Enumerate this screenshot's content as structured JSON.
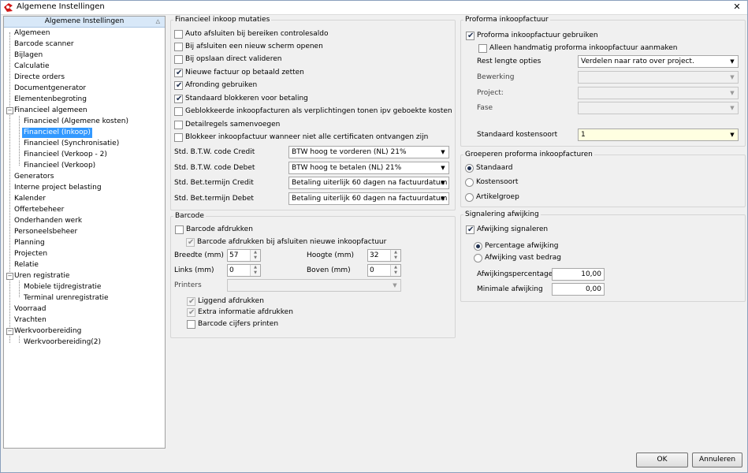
{
  "window": {
    "title": "Algemene Instellingen",
    "close_glyph": "✕"
  },
  "tree": {
    "header": "Algemene Instellingen",
    "header_arrow": "△",
    "items": [
      {
        "label": "Algemeen"
      },
      {
        "label": "Barcode scanner"
      },
      {
        "label": "Bijlagen"
      },
      {
        "label": "Calculatie"
      },
      {
        "label": "Directe orders"
      },
      {
        "label": "Documentgenerator"
      },
      {
        "label": "Elementenbegroting"
      },
      {
        "label": "Financieel algemeen"
      },
      {
        "label": "Financieel (Algemene kosten)"
      },
      {
        "label": "Financieel (Inkoop)"
      },
      {
        "label": "Financieel (Synchronisatie)"
      },
      {
        "label": "Financieel (Verkoop - 2)"
      },
      {
        "label": "Financieel (Verkoop)"
      },
      {
        "label": "Generators"
      },
      {
        "label": "Interne project belasting"
      },
      {
        "label": "Kalender"
      },
      {
        "label": "Offertebeheer"
      },
      {
        "label": "Onderhanden werk"
      },
      {
        "label": "Personeelsbeheer"
      },
      {
        "label": "Planning"
      },
      {
        "label": "Projecten"
      },
      {
        "label": "Relatie"
      },
      {
        "label": "Uren registratie"
      },
      {
        "label": "Mobiele tijdregistratie"
      },
      {
        "label": "Terminal urenregistratie"
      },
      {
        "label": "Voorraad"
      },
      {
        "label": "Vrachten"
      },
      {
        "label": "Werkvoorbereiding"
      },
      {
        "label": "Werkvoorbereiding(2)"
      }
    ],
    "selected": "Financieel (Inkoop)"
  },
  "fin": {
    "title": "Financieel inkoop mutaties",
    "checks": [
      {
        "label": "Auto afsluiten bij bereiken controlesaldo",
        "checked": false
      },
      {
        "label": "Bij afsluiten een nieuw scherm openen",
        "checked": false
      },
      {
        "label": "Bij opslaan direct valideren",
        "checked": false
      },
      {
        "label": "Nieuwe factuur op betaald zetten",
        "checked": true
      },
      {
        "label": "Afronding gebruiken",
        "checked": true
      },
      {
        "label": "Standaard blokkeren voor betaling",
        "checked": true
      },
      {
        "label": "Geblokkeerde inkoopfacturen als verplichtingen tonen ipv geboekte kosten",
        "checked": false
      },
      {
        "label": "Detailregels samenvoegen",
        "checked": false
      },
      {
        "label": "Blokkeer inkoopfactuur wanneer niet alle certificaten ontvangen zijn",
        "checked": false
      }
    ],
    "fields": [
      {
        "label": "Std. B.T.W. code Credit",
        "value": "BTW hoog te vorderen (NL) 21%"
      },
      {
        "label": "Std. B.T.W. code Debet",
        "value": "BTW hoog te betalen (NL) 21%"
      },
      {
        "label": "Std. Bet.termijn Credit",
        "value": "Betaling uiterlijk 60 dagen na factuurdatum"
      },
      {
        "label": "Std. Bet.termijn Debet",
        "value": "Betaling uiterlijk 60 dagen na factuurdatum"
      }
    ]
  },
  "barcode": {
    "title": "Barcode",
    "print": {
      "label": "Barcode afdrukken",
      "checked": false
    },
    "print_on_close": {
      "label": "Barcode afdrukken bij afsluiten nieuwe inkoopfactuur",
      "checked": true
    },
    "width": {
      "label": "Breedte (mm)",
      "value": "57"
    },
    "height": {
      "label": "Hoogte (mm)",
      "value": "32"
    },
    "left": {
      "label": "Links (mm)",
      "value": "0"
    },
    "top": {
      "label": "Boven (mm)",
      "value": "0"
    },
    "printers": {
      "label": "Printers",
      "value": ""
    },
    "landscape": {
      "label": "Liggend afdrukken",
      "checked": true
    },
    "extra": {
      "label": "Extra informatie afdrukken",
      "checked": true
    },
    "digits": {
      "label": "Barcode cijfers printen",
      "checked": false
    }
  },
  "proforma": {
    "title": "Proforma inkoopfactuur",
    "use": {
      "label": "Proforma inkoopfactuur gebruiken",
      "checked": true
    },
    "manual": {
      "label": "Alleen handmatig proforma inkoopfactuur aanmaken",
      "checked": false
    },
    "rest": {
      "label": "Rest lengte opties",
      "value": "Verdelen naar rato over project."
    },
    "bewerking": {
      "label": "Bewerking",
      "value": ""
    },
    "project": {
      "label": "Project:",
      "value": ""
    },
    "fase": {
      "label": "Fase",
      "value": ""
    },
    "kostensoort": {
      "label": "Standaard kostensoort",
      "value": "1"
    }
  },
  "group": {
    "title": "Groeperen proforma inkoopfacturen",
    "options": [
      {
        "label": "Standaard",
        "checked": true
      },
      {
        "label": "Kostensoort",
        "checked": false
      },
      {
        "label": "Artikelgroep",
        "checked": false
      }
    ]
  },
  "signal": {
    "title": "Signalering afwijking",
    "enable": {
      "label": "Afwijking signaleren",
      "checked": true
    },
    "options": [
      {
        "label": "Percentage afwijking",
        "checked": true
      },
      {
        "label": "Afwijking vast bedrag",
        "checked": false
      }
    ],
    "percentage": {
      "label": "Afwijkingspercentage",
      "value": "10,00"
    },
    "minimum": {
      "label": "Minimale afwijking",
      "value": "0,00"
    }
  },
  "buttons": {
    "ok": "OK",
    "cancel": "Annuleren"
  },
  "colors": {
    "selection": "#3399ff",
    "window_bg": "#f0f0f0",
    "required_field": "#ffffe1"
  }
}
